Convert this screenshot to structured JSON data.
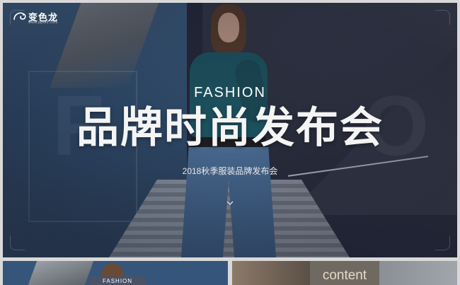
{
  "brand": {
    "name": "变色龙",
    "url": "www.ppt80.com"
  },
  "hero": {
    "subtitle": "FASHION",
    "title": "品牌时尚发布会",
    "caption": "2018秋季服装品牌发布会",
    "ghost_left": "F",
    "ghost_right": "O"
  },
  "thumbnails": [
    {
      "label": "FASHION"
    },
    {
      "label": "content"
    }
  ],
  "colors": {
    "background": "#24283a",
    "text": "#ffffff",
    "thumbnail_accent": "#e9d8c4"
  },
  "icons": {
    "logo": "chameleon-logo-icon",
    "scroll": "chevron-down-icon"
  }
}
